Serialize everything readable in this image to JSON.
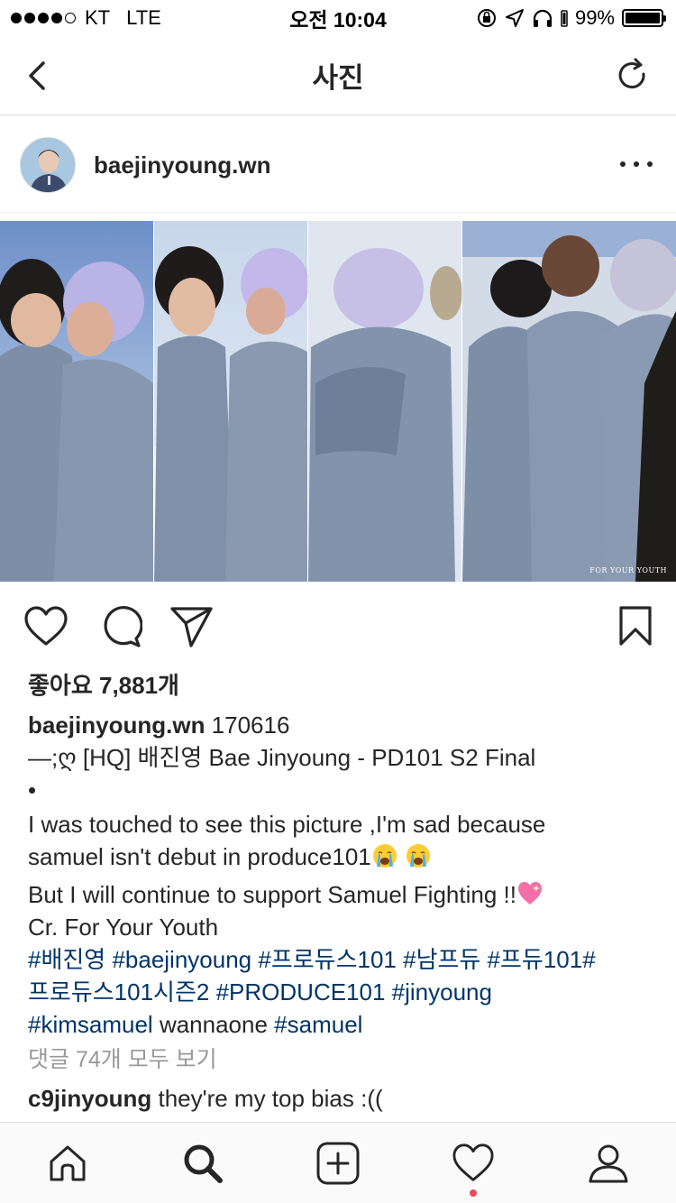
{
  "status_bar": {
    "carrier": "KT",
    "network": "LTE",
    "time": "오전 10:04",
    "battery": "99%",
    "battery_level": 0.99
  },
  "nav": {
    "title": "사진",
    "back_icon": "chevron-left-icon",
    "refresh_icon": "refresh-icon"
  },
  "post": {
    "username": "baejinyoung.wn",
    "photo_watermark": "FOR YOUR YOUTH",
    "likes": "좋아요 7,881개",
    "caption": {
      "username": "baejinyoung.wn",
      "date": " 170616",
      "line1": "—;ღ [HQ] 배진영 Bae Jinyoung - PD101 S2 Final",
      "line2": "•",
      "line3": "I was touched to see this picture ,I'm sad because",
      "line4": "samuel isn't debut in produce101",
      "line5": "But I will continue to support Samuel Fighting !!",
      "line6": "Cr. For Your Youth",
      "tags1": "#배진영 #baejinyoung #프로듀스101 #남프듀 #프듀101#",
      "tags2": "프로듀스101시즌2 #PRODUCE101 #jinyoung",
      "tags3a": "#kimsamuel",
      "tags3b": " wannaone ",
      "tags3c": "#samuel"
    },
    "view_comments": "댓글 74개 모두 보기",
    "comment": {
      "username": "c9jinyoung",
      "text": " they're my top bias :(("
    }
  },
  "tab_bar": {
    "items": [
      "home-icon",
      "search-icon",
      "add-post-icon",
      "activity-heart-icon",
      "profile-icon"
    ],
    "active": "search-icon"
  },
  "colors": {
    "hashtag": "#003569",
    "muted": "#999999",
    "text": "#262626",
    "notification": "#ed4956"
  }
}
